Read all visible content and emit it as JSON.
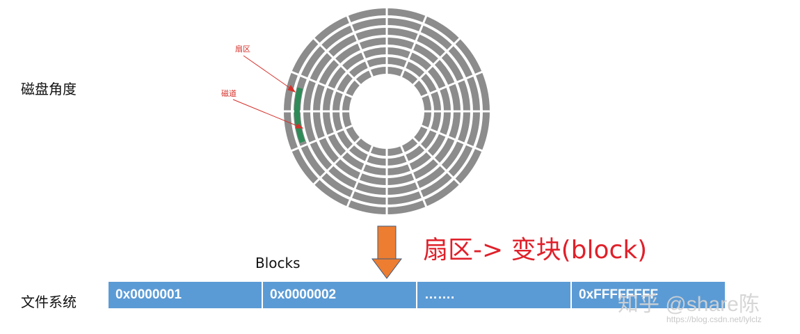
{
  "labels": {
    "disk_view": "磁盘角度",
    "filesystem_view": "文件系统",
    "sector_annotation": "扇区",
    "track_annotation": "磁道",
    "blocks_title": "Blocks"
  },
  "caption": "扇区-> 变块(block)",
  "blocks": [
    "0x0000001",
    "0x0000002",
    "…….",
    "0xFFFFFFFF"
  ],
  "watermark": {
    "main": "知乎 @share陈",
    "url": "https://blog.csdn.net/lylclz"
  },
  "colors": {
    "track": "#8c8c8c",
    "highlighted_sector": "#2e8b57",
    "arrow": "#ed7d31",
    "annotation": "#d4302a",
    "block_fill": "#5b9bd5",
    "caption": "#e0202a"
  },
  "disk": {
    "track_count": 7,
    "sector_dividers": 16
  }
}
